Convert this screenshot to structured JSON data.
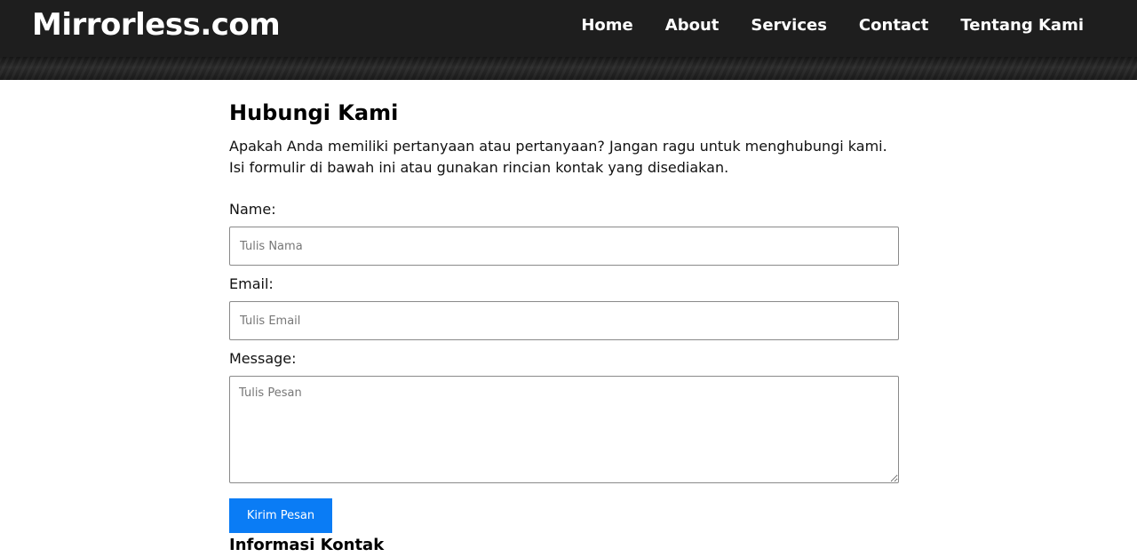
{
  "header": {
    "brand": "Mirrorless.com",
    "nav": [
      "Home",
      "About",
      "Services",
      "Contact",
      "Tentang Kami"
    ]
  },
  "main": {
    "title": "Hubungi Kami",
    "intro_line1": "Apakah Anda memiliki pertanyaan atau pertanyaan? Jangan ragu untuk menghubungi kami.",
    "intro_line2": "Isi formulir di bawah ini atau gunakan rincian kontak yang disediakan.",
    "form": {
      "name_label": "Name:",
      "name_placeholder": "Tulis Nama",
      "email_label": "Email:",
      "email_placeholder": "Tulis Email",
      "message_label": "Message:",
      "message_placeholder": "Tulis Pesan",
      "submit_label": "Kirim Pesan"
    },
    "contact_heading": "Informasi Kontak"
  },
  "colors": {
    "navbar_bg": "#1e1e1e",
    "accent": "#0a7cf5"
  }
}
